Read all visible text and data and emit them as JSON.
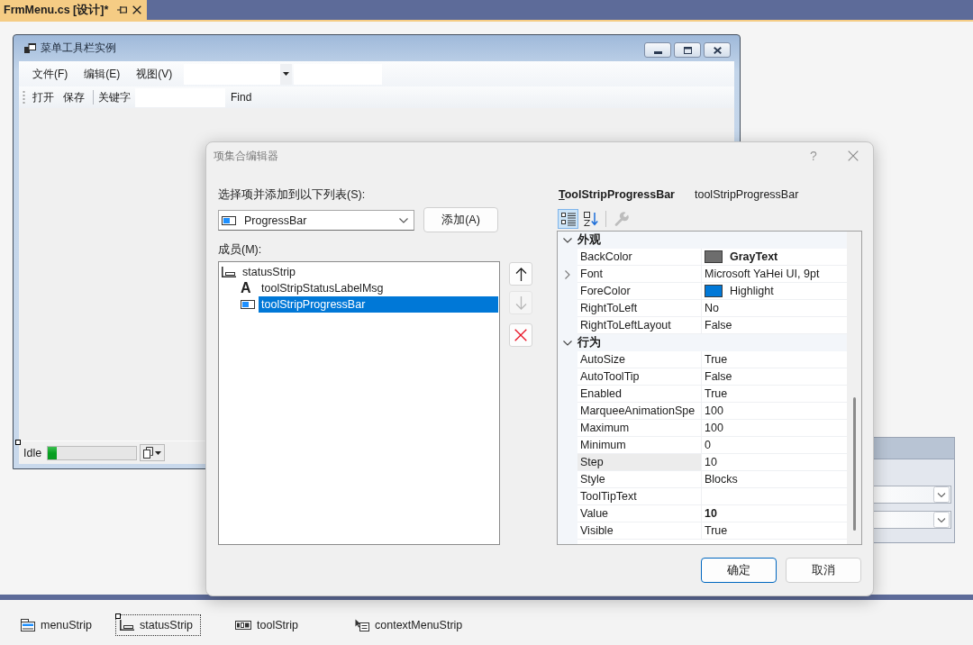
{
  "document_tab": {
    "title": "FrmMenu.cs [设计]*",
    "selected": true
  },
  "form": {
    "title": "菜单工具栏实例",
    "menu_strip": [
      {
        "kind": "menu",
        "label": "文件(F)"
      },
      {
        "kind": "menu",
        "label": "编辑(E)"
      },
      {
        "kind": "menu",
        "label": "视图(V)"
      },
      {
        "kind": "combobox"
      },
      {
        "kind": "textbox"
      }
    ],
    "tool_strip": [
      {
        "kind": "button",
        "label": "打开"
      },
      {
        "kind": "button",
        "label": "保存"
      },
      {
        "kind": "separator"
      },
      {
        "kind": "label",
        "label": "关键字"
      },
      {
        "kind": "textbox"
      },
      {
        "kind": "button",
        "label": "Find"
      }
    ],
    "status_strip": {
      "selected": true,
      "label": "Idle",
      "progress": {
        "level": 0.1
      }
    }
  },
  "dialog": {
    "title": "项集合编辑器",
    "help": "?",
    "add_label": "选择项并添加到以下列表(S):",
    "item_type": "ProgressBar",
    "add_button": "添加(A)",
    "members_label": "成员(M):",
    "members": [
      {
        "kind": "status-strip",
        "label": "statusStrip",
        "selected": false,
        "children": [
          {
            "kind": "label",
            "glyph": "A",
            "label": "toolStripStatusLabelMsg",
            "selected": false
          },
          {
            "kind": "progress-bar",
            "label": "toolStripProgressBar",
            "selected": true
          }
        ]
      }
    ],
    "member_buttons": [
      {
        "kind": "up",
        "disabled": false
      },
      {
        "kind": "down",
        "disabled": true
      },
      {
        "kind": "delete",
        "disabled": false
      }
    ],
    "property_header": {
      "type": "ToolStripProgressBar",
      "name": "toolStripProgressBar"
    },
    "property_toolbar": [
      {
        "kind": "categorized",
        "selected": true,
        "disabled": false
      },
      {
        "kind": "alphabetical",
        "selected": false,
        "disabled": false
      },
      {
        "kind": "property-pages",
        "selected": false,
        "disabled": true
      }
    ],
    "categories": [
      {
        "label": "外观",
        "expanded": true,
        "properties": [
          {
            "kind": "color",
            "name": "BackColor",
            "color": "#6d6d6d",
            "value": "GrayText",
            "modified": true,
            "selected": false
          },
          {
            "kind": "expandable",
            "name": "Font",
            "value": "Microsoft YaHei UI, 9pt",
            "modified": false,
            "selected": false
          },
          {
            "kind": "color",
            "name": "ForeColor",
            "color": "#0078d7",
            "value": "Highlight",
            "modified": false,
            "selected": false
          },
          {
            "kind": "text",
            "name": "RightToLeft",
            "value": "No",
            "modified": false,
            "selected": false
          },
          {
            "kind": "text",
            "name": "RightToLeftLayout",
            "value": "False",
            "modified": false,
            "selected": false
          }
        ]
      },
      {
        "label": "行为",
        "expanded": true,
        "properties": [
          {
            "kind": "text",
            "name": "AutoSize",
            "value": "True",
            "modified": false,
            "selected": false
          },
          {
            "kind": "text",
            "name": "AutoToolTip",
            "value": "False",
            "modified": false,
            "selected": false
          },
          {
            "kind": "text",
            "name": "Enabled",
            "value": "True",
            "modified": false,
            "selected": false
          },
          {
            "kind": "text",
            "name": "MarqueeAnimationSpe",
            "value": "100",
            "modified": false,
            "selected": false
          },
          {
            "kind": "text",
            "name": "Maximum",
            "value": "100",
            "modified": false,
            "selected": false
          },
          {
            "kind": "text",
            "name": "Minimum",
            "value": "0",
            "modified": false,
            "selected": false
          },
          {
            "kind": "text",
            "name": "Step",
            "value": "10",
            "modified": false,
            "selected": true
          },
          {
            "kind": "text",
            "name": "Style",
            "value": "Blocks",
            "modified": false,
            "selected": false
          },
          {
            "kind": "text",
            "name": "ToolTipText",
            "selected": false
          },
          {
            "kind": "text",
            "name": "Value",
            "value": "10",
            "modified": true,
            "selected": false
          },
          {
            "kind": "text",
            "name": "Visible",
            "value": "True",
            "modified": false,
            "selected": false
          }
        ]
      }
    ],
    "buttons": [
      {
        "label": "确定",
        "default": true
      },
      {
        "label": "取消",
        "default": false
      }
    ]
  },
  "component_tray": [
    {
      "kind": "menu",
      "label": "menuStrip",
      "selected": false
    },
    {
      "kind": "status",
      "label": "statusStrip",
      "selected": true
    },
    {
      "kind": "toolbar",
      "label": "toolStrip",
      "selected": false
    },
    {
      "kind": "context-menu",
      "label": "contextMenuStrip",
      "selected": false
    }
  ]
}
